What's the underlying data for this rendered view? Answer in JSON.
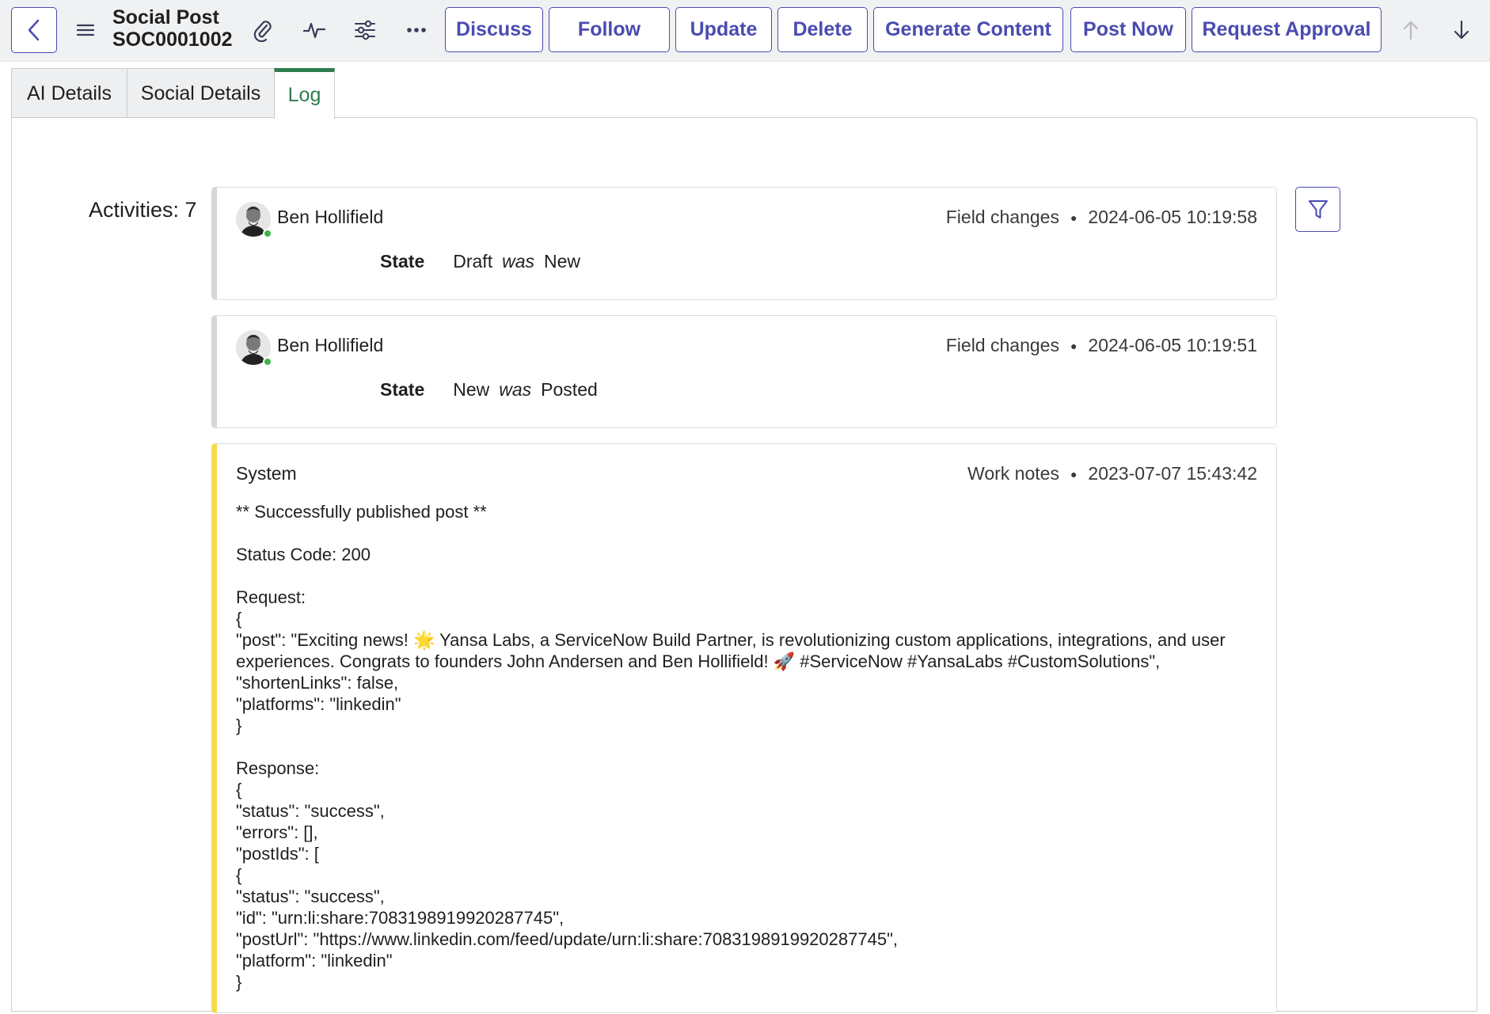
{
  "header": {
    "title_line1": "Social Post",
    "title_line2": "SOC0001002",
    "buttons": [
      "Discuss",
      "Follow",
      "Update",
      "Delete",
      "Generate Content",
      "Post Now",
      "Request Approval"
    ],
    "icons": {
      "back": "chevron-left-icon",
      "menu": "hamburger-menu-icon",
      "attachment": "paperclip-icon",
      "activity": "pulse-icon",
      "settings": "sliders-icon",
      "more": "ellipsis-icon",
      "prev": "arrow-up-icon",
      "next": "arrow-down-icon"
    },
    "accent_color": "#4a4bb0"
  },
  "tabs": [
    {
      "label": "AI Details",
      "active": false
    },
    {
      "label": "Social Details",
      "active": false
    },
    {
      "label": "Log",
      "active": true
    }
  ],
  "log": {
    "activities_label": "Activities: 7",
    "entries": [
      {
        "author": "Ben Hollifield",
        "type": "Field changes",
        "timestamp": "2024-06-05 10:19:58",
        "field": "State",
        "new_value": "Draft",
        "was": "was",
        "old_value": "New"
      },
      {
        "author": "Ben Hollifield",
        "type": "Field changes",
        "timestamp": "2024-06-05 10:19:51",
        "field": "State",
        "new_value": "New",
        "was": "was",
        "old_value": "Posted"
      },
      {
        "author": "System",
        "type": "Work notes",
        "timestamp": "2023-07-07 15:43:42",
        "lines": {
          "l1": "** Successfully published post **",
          "l2": "Status Code: 200",
          "l3": "Request:",
          "l4": "{",
          "l5a": "\"post\": \"Exciting news! 🌟 Yansa Labs, a ServiceNow Build Partner, is revolutionizing custom applications, integrations, and user",
          "l5b": "experiences. Congrats to founders John Andersen and Ben Hollifield! 🚀 #ServiceNow #YansaLabs #CustomSolutions\",",
          "l6": "\"shortenLinks\": false,",
          "l7": "\"platforms\": \"linkedin\"",
          "l8": "}",
          "l9": "Response:",
          "l10": "{",
          "l11": "\"status\": \"success\",",
          "l12": "\"errors\": [],",
          "l13": "\"postIds\": [",
          "l14": "{",
          "l15": "\"status\": \"success\",",
          "l16": "\"id\": \"urn:li:share:7083198919920287745\",",
          "l17": "\"postUrl\": \"https://www.linkedin.com/feed/update/urn:li:share:7083198919920287745\",",
          "l18": "\"platform\": \"linkedin\"",
          "l19": "}"
        }
      }
    ]
  }
}
